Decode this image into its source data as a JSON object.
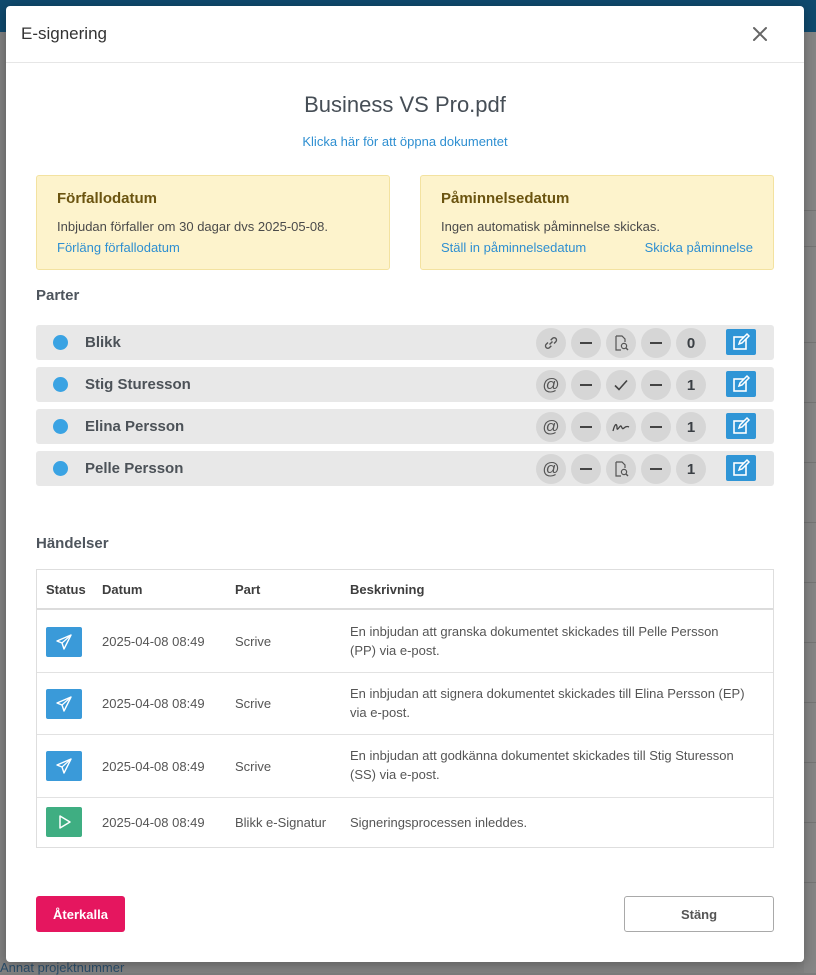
{
  "background": {
    "bottom_text": "Annat projektnummer"
  },
  "modal": {
    "title": "E-signering",
    "document_title": "Business VS Pro.pdf",
    "open_link": "Klicka här för att öppna dokumentet"
  },
  "expiry_card": {
    "title": "Förfallodatum",
    "text": "Inbjudan förfaller om 30 dagar dvs 2025-05-08.",
    "link": "Förläng förfallodatum"
  },
  "reminder_card": {
    "title": "Påminnelsedatum",
    "text": "Ingen automatisk påminnelse skickas.",
    "link_set": "Ställ in påminnelsedatum",
    "link_send": "Skicka påminnelse"
  },
  "parties": {
    "title": "Parter",
    "items": [
      {
        "name": "Blikk",
        "delivery": "link-icon",
        "role": "review-icon",
        "count": "0"
      },
      {
        "name": "Stig Sturesson",
        "delivery": "@",
        "role": "approve-check-icon",
        "count": "1"
      },
      {
        "name": "Elina Persson",
        "delivery": "@",
        "role": "signature-icon",
        "count": "1"
      },
      {
        "name": "Pelle Persson",
        "delivery": "@",
        "role": "review-icon",
        "count": "1"
      }
    ]
  },
  "events": {
    "title": "Händelser",
    "headers": {
      "status": "Status",
      "date": "Datum",
      "party": "Part",
      "description": "Beskrivning"
    },
    "rows": [
      {
        "status": "sent",
        "date": "2025-04-08 08:49",
        "party": "Scrive",
        "description_1": "En inbjudan att granska dokumentet skickades till Pelle Persson",
        "description_2": "(PP) via e-post."
      },
      {
        "status": "sent",
        "date": "2025-04-08 08:49",
        "party": "Scrive",
        "description_1": "En inbjudan att signera dokumentet skickades till Elina Persson (EP)",
        "description_2": "via e-post."
      },
      {
        "status": "sent",
        "date": "2025-04-08 08:49",
        "party": "Scrive",
        "description_1": "En inbjudan att godkänna dokumentet skickades till Stig Sturesson",
        "description_2": "(SS) via e-post."
      },
      {
        "status": "started",
        "date": "2025-04-08 08:49",
        "party": "Blikk e-Signatur",
        "description_1": "Signeringsprocessen inleddes.",
        "description_2": ""
      }
    ]
  },
  "footer": {
    "revoke_label": "Återkalla",
    "close_label": "Stäng"
  },
  "colors": {
    "accent_blue": "#2f95d6",
    "revoke_pink": "#e5165f",
    "sent_blue": "#3a9ad9",
    "started_green": "#3fae82",
    "card_yellow": "#fdf3cc"
  }
}
